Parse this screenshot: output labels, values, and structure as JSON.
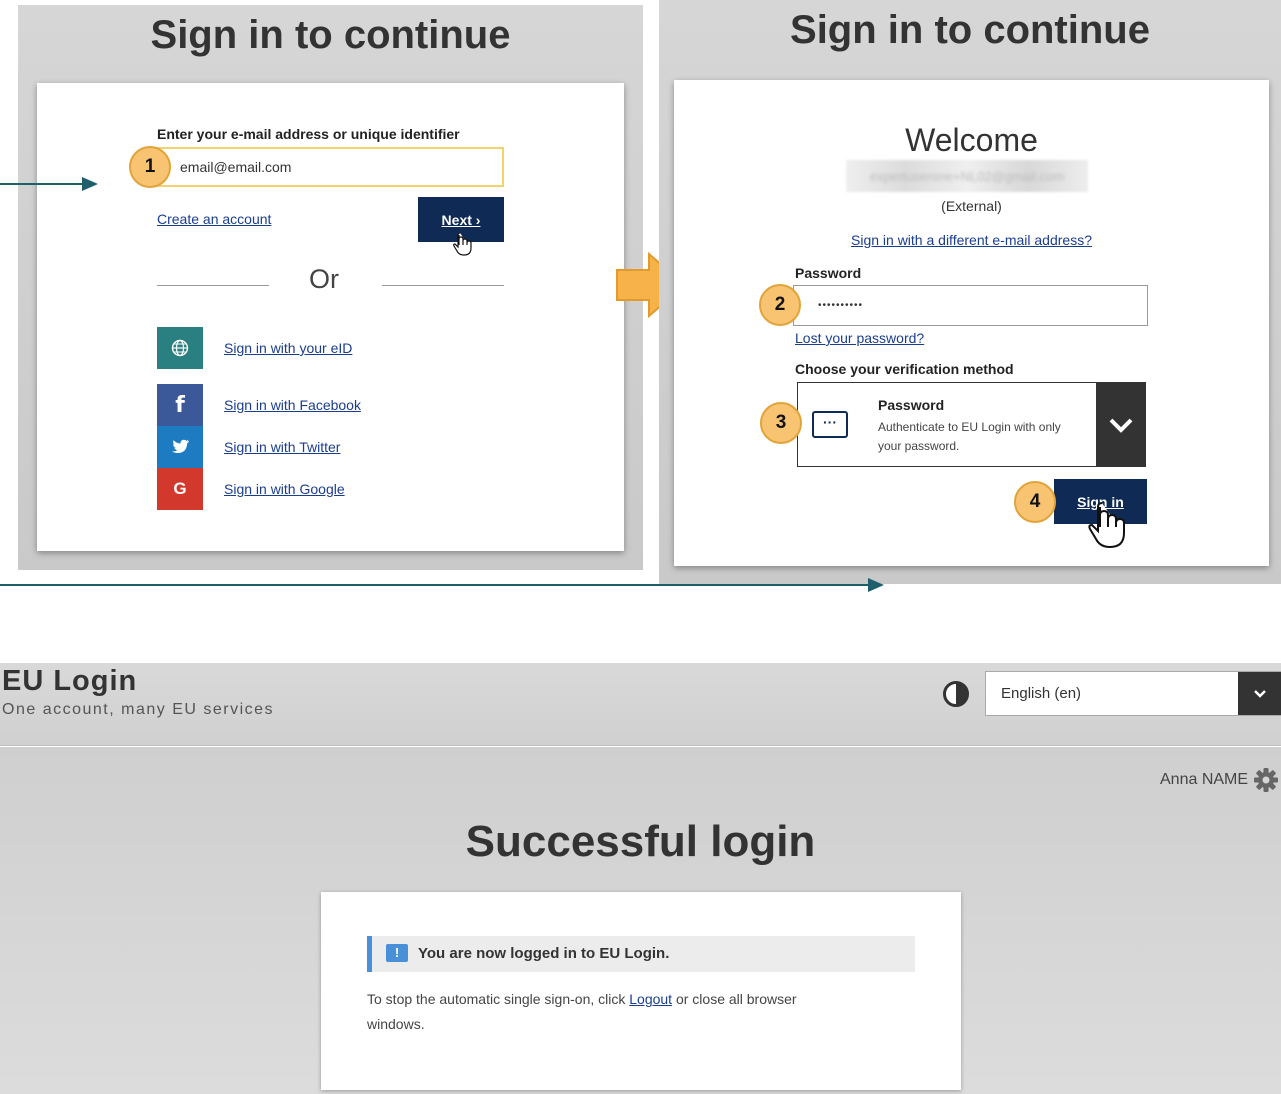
{
  "left_panel": {
    "title": "Sign in to continue",
    "email_label": "Enter your e-mail address or unique identifier",
    "email_value": "email@email.com",
    "step1": "1",
    "create_account": "Create an account",
    "next_label": "Next ›",
    "or_label": "Or",
    "social": [
      {
        "label": "Sign in with your eID",
        "icon": "globe-icon",
        "color": "#2a7f80"
      },
      {
        "label": "Sign in with Facebook",
        "icon": "facebook-icon",
        "color": "#3b5998"
      },
      {
        "label": "Sign in with Twitter",
        "icon": "twitter-icon",
        "color": "#1d7bc1"
      },
      {
        "label": "Sign in with Google",
        "icon": "google-icon",
        "color": "#d2382b"
      }
    ]
  },
  "right_panel": {
    "title": "Sign in to continue",
    "welcome": "Welcome",
    "blurred_email": "expertuserone+NL02@gmail.com",
    "external": "(External)",
    "different_email": "Sign in with a different e-mail address?",
    "password_label": "Password",
    "password_value": "••••••••••",
    "step2": "2",
    "lost_password": "Lost your password?",
    "verification_label": "Choose your verification method",
    "step3": "3",
    "method_title": "Password",
    "method_desc_line1": "Authenticate to EU Login with only",
    "method_desc_line2": "your password.",
    "step4": "4",
    "signin_label": "Sign in"
  },
  "eu_login": {
    "title": "EU Login",
    "subtitle": "One account, many EU services",
    "language": "English (en)",
    "user_name": "Anna NAME",
    "heading": "Successful login",
    "notice": "You are now logged in to EU Login.",
    "info_before": "To stop the automatic single sign-on, click ",
    "logout_link": "Logout",
    "info_after": " or close all browser",
    "info_line2": "windows."
  },
  "colors": {
    "accent_dark": "#0e2a55",
    "badge": "#f8c471",
    "arrow": "#f7b24a",
    "connector": "#1f5f6b"
  }
}
